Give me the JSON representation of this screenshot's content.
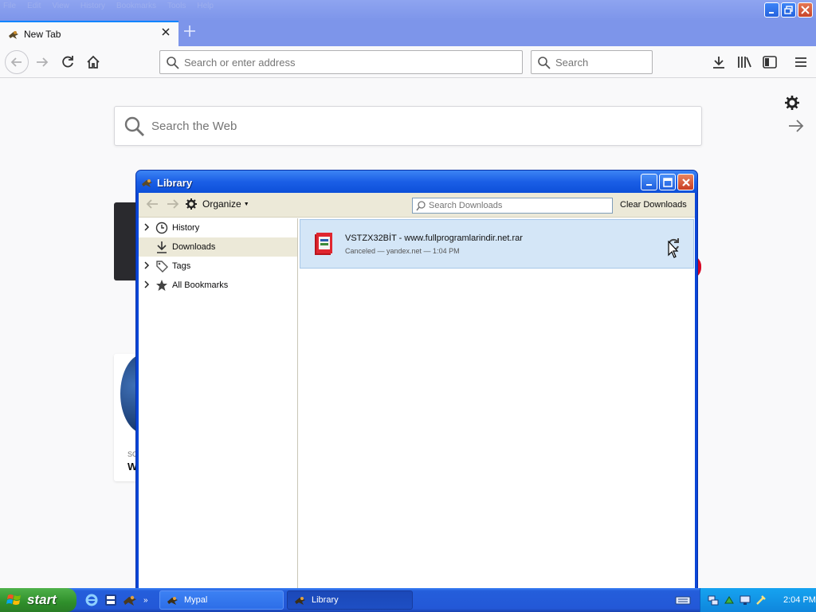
{
  "browser": {
    "menu": [
      "File",
      "Edit",
      "View",
      "History",
      "Bookmarks",
      "Tools",
      "Help"
    ],
    "tab_title": "New Tab",
    "address_placeholder": "Search or enter address",
    "search_placeholder": "Search"
  },
  "newtab": {
    "web_search_placeholder": "Search the Web",
    "highlight_source": "SC",
    "highlight_title": "W"
  },
  "library": {
    "title": "Library",
    "organize_label": "Organize",
    "search_placeholder": "Search Downloads",
    "clear_label": "Clear Downloads",
    "tree": [
      {
        "label": "History"
      },
      {
        "label": "Downloads"
      },
      {
        "label": "Tags"
      },
      {
        "label": "All Bookmarks"
      }
    ],
    "download": {
      "filename": "VSTZX32BİT - www.fullprogramlarindir.net.rar",
      "status": "Canceled — yandex.net — 1:04 PM"
    }
  },
  "taskbar": {
    "start_label": "start",
    "tasks": [
      {
        "label": "Mypal"
      },
      {
        "label": "Library"
      }
    ],
    "clock": "2:04 PM"
  },
  "colors": {
    "xp_blue": "#0a46d8",
    "selection": "#d4e6f7",
    "start_green": "#2f8f2b",
    "firefox_accent": "#0a84ff"
  }
}
